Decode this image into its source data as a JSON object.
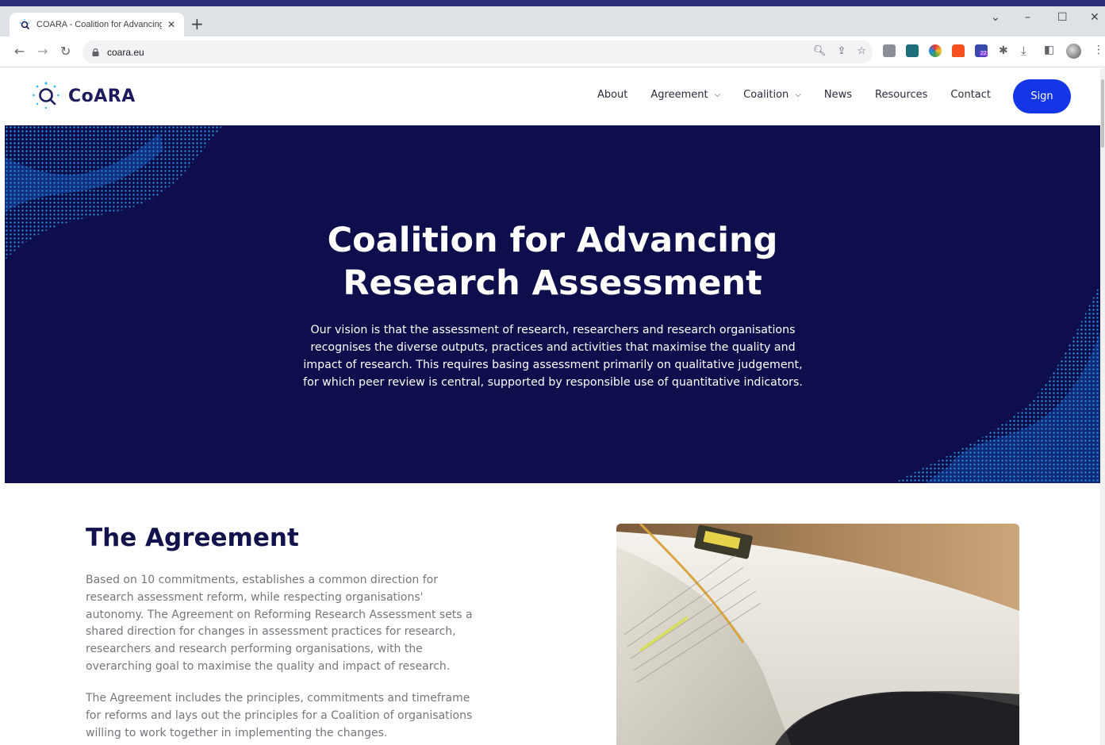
{
  "browser": {
    "tab_title": "COARA - Coalition for Advancing",
    "new_tab_icon": "+",
    "url": "coara.eu"
  },
  "header": {
    "logo_text": "CoARA",
    "nav": [
      {
        "label": "About",
        "has_dropdown": false
      },
      {
        "label": "Agreement",
        "has_dropdown": true
      },
      {
        "label": "Coalition",
        "has_dropdown": true
      },
      {
        "label": "News",
        "has_dropdown": false
      },
      {
        "label": "Resources",
        "has_dropdown": false
      },
      {
        "label": "Contact",
        "has_dropdown": false
      }
    ],
    "sign_label": "Sign"
  },
  "hero": {
    "title_line1": "Coalition for Advancing",
    "title_line2": "Research Assessment",
    "text_lines": [
      "Our vision is that the assessment of research, researchers and research organisations",
      "recognises the diverse outputs, practices and activities that maximise the quality and",
      "impact of research. This requires basing assessment primarily on qualitative judgement,",
      "for which peer review is central, supported by responsible use of quantitative indicators."
    ]
  },
  "agreement": {
    "title": "The Agreement",
    "paragraph1_lines": [
      "Based on 10 commitments, establishes a common direction for",
      "research assessment reform, while respecting organisations'",
      "autonomy. The Agreement on Reforming Research Assessment sets a",
      "shared direction for changes in assessment practices for research,",
      "researchers and research performing organisations, with the",
      "overarching goal to maximise the quality and impact of research."
    ],
    "paragraph2_lines": [
      "The Agreement includes the principles, commitments and timeframe",
      "for reforms and lays out the principles for a Coalition of organisations",
      "willing to work together in implementing the changes."
    ]
  },
  "extension_badge": "22",
  "colors": {
    "hero_bg": "#0f0e4c",
    "brand_navy": "#12124d",
    "sign_button": "#1436e6",
    "dots": "#2fb8ff"
  }
}
